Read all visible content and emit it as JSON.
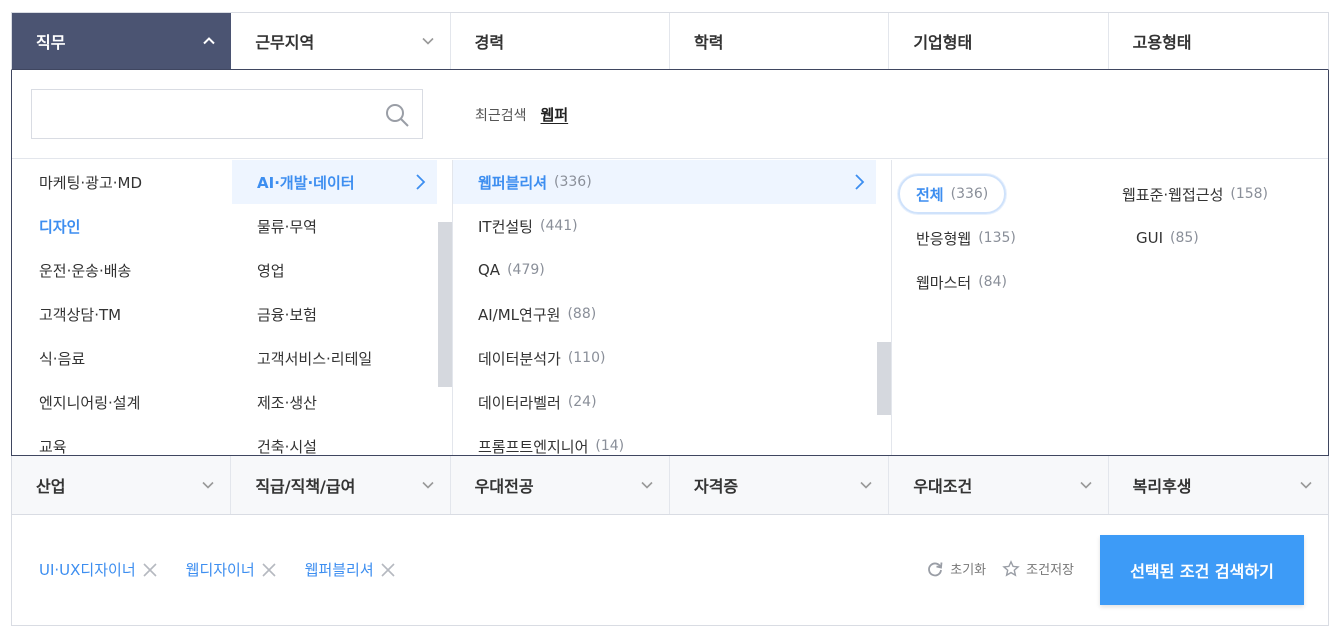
{
  "top_tabs": [
    {
      "label": "직무",
      "active": true,
      "has_chevron": true
    },
    {
      "label": "근무지역",
      "active": false,
      "has_chevron": true
    },
    {
      "label": "경력",
      "active": false,
      "has_chevron": false
    },
    {
      "label": "학력",
      "active": false,
      "has_chevron": false
    },
    {
      "label": "기업형태",
      "active": false,
      "has_chevron": false
    },
    {
      "label": "고용형태",
      "active": false,
      "has_chevron": false
    }
  ],
  "search": {
    "placeholder": "",
    "value": "",
    "recent_label": "최근검색",
    "recent_keyword": "웹퍼"
  },
  "category_level1": [
    {
      "label": "마케팅·광고·MD"
    },
    {
      "label": "디자인",
      "highlight": true
    },
    {
      "label": "운전·운송·배송"
    },
    {
      "label": "고객상담·TM"
    },
    {
      "label": "식·음료"
    },
    {
      "label": "엔지니어링·설계"
    },
    {
      "label": "교육"
    }
  ],
  "category_level2": [
    {
      "label": "AI·개발·데이터",
      "selected": true
    },
    {
      "label": "물류·무역"
    },
    {
      "label": "영업"
    },
    {
      "label": "금융·보험"
    },
    {
      "label": "고객서비스·리테일"
    },
    {
      "label": "제조·생산"
    },
    {
      "label": "건축·시설"
    }
  ],
  "category_level3": [
    {
      "label": "웹퍼블리셔",
      "count": "(336)",
      "selected": true
    },
    {
      "label": "IT컨설팅",
      "count": "(441)"
    },
    {
      "label": "QA",
      "count": "(479)"
    },
    {
      "label": "AI/ML연구원",
      "count": "(88)"
    },
    {
      "label": "데이터분석가",
      "count": "(110)"
    },
    {
      "label": "데이터라벨러",
      "count": "(24)"
    },
    {
      "label": "프롬프트엔지니어",
      "count": "(14)"
    }
  ],
  "category_level4": [
    {
      "label": "전체",
      "count": "(336)",
      "selected": true
    },
    {
      "label": "웹표준·웹접근성",
      "count": "(158)"
    },
    {
      "label": "반응형웹",
      "count": "(135)"
    },
    {
      "label": "GUI",
      "count": "(85)"
    },
    {
      "label": "웹마스터",
      "count": "(84)"
    }
  ],
  "bottom_tabs": [
    {
      "label": "산업"
    },
    {
      "label": "직급/직책/급여"
    },
    {
      "label": "우대전공"
    },
    {
      "label": "자격증"
    },
    {
      "label": "우대조건"
    },
    {
      "label": "복리후생"
    }
  ],
  "selected_chips": [
    {
      "label": "UI·UX디자이너"
    },
    {
      "label": "웹디자이너"
    },
    {
      "label": "웹퍼블리셔"
    }
  ],
  "actions": {
    "reset_label": "초기화",
    "save_label": "조건저장"
  },
  "search_button_label": "선택된 조건 검색하기",
  "colors": {
    "accent": "#3d8ef0",
    "active_tab_bg": "#4b5472",
    "button_bg": "#3d9bf7"
  }
}
